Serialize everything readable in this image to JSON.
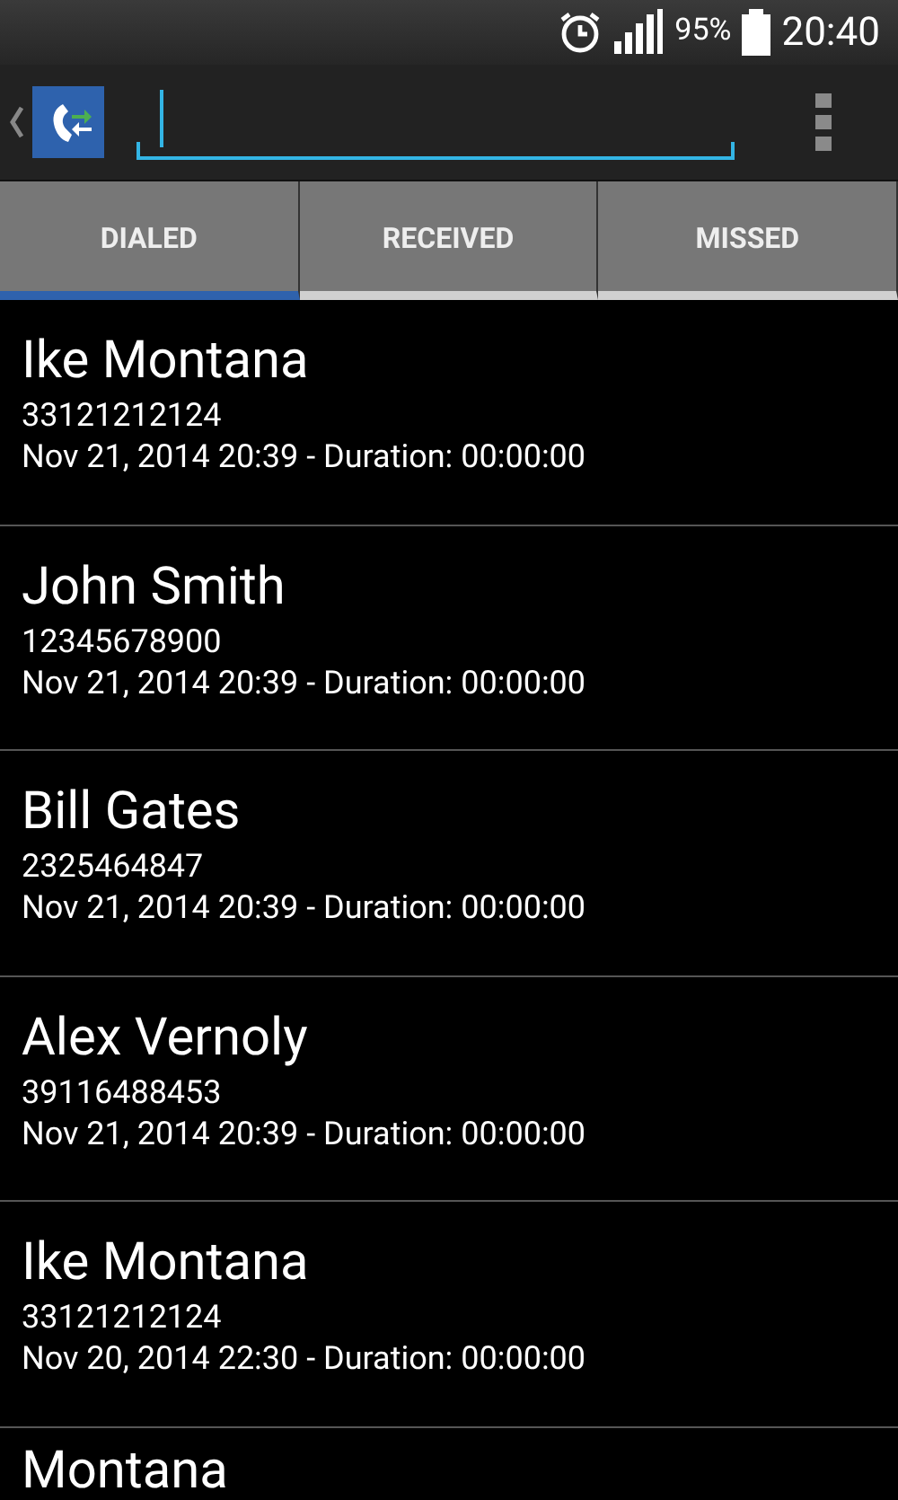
{
  "status_bar": {
    "battery_percent": "95%",
    "time": "20:40"
  },
  "tabs": [
    {
      "label": "DIALED",
      "selected": true
    },
    {
      "label": "RECEIVED",
      "selected": false
    },
    {
      "label": "MISSED",
      "selected": false
    }
  ],
  "calls": [
    {
      "name": "Ike Montana",
      "number": "33121212124",
      "details": "Nov 21, 2014 20:39 - Duration: 00:00:00"
    },
    {
      "name": "John Smith",
      "number": "12345678900",
      "details": "Nov 21, 2014 20:39 - Duration: 00:00:00"
    },
    {
      "name": "Bill Gates",
      "number": "2325464847",
      "details": "Nov 21, 2014 20:39 - Duration: 00:00:00"
    },
    {
      "name": "Alex Vernoly",
      "number": "39116488453",
      "details": "Nov 21, 2014 20:39 - Duration: 00:00:00"
    },
    {
      "name": "Ike Montana",
      "number": "33121212124",
      "details": "Nov 20, 2014 22:30 - Duration: 00:00:00"
    },
    {
      "name": "Montana"
    }
  ]
}
